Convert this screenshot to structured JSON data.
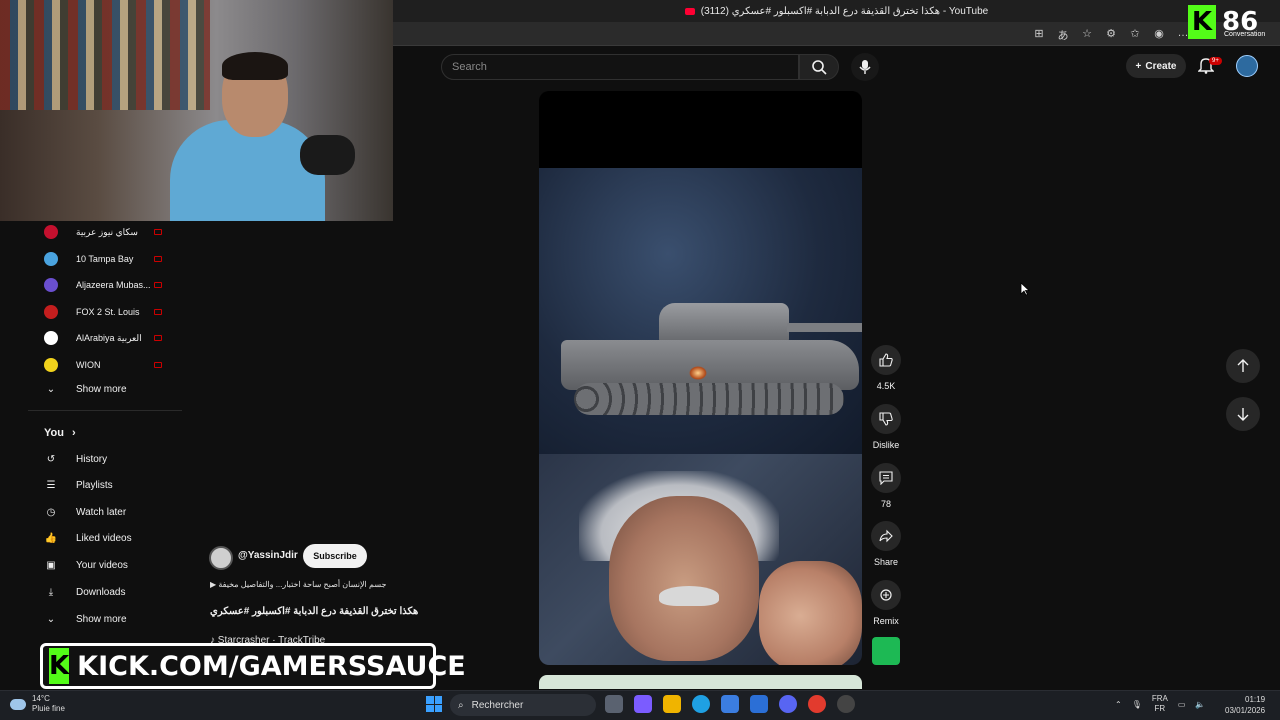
{
  "browser": {
    "tab_title": "(3112) هكذا تخترق القذيفة درع الدبابة #اكسبلور #عسكري - YouTube"
  },
  "kick_overlay": {
    "count": "86",
    "label": "Conversation"
  },
  "header": {
    "search_placeholder": "Search",
    "create_label": "Create",
    "notif_badge": "9+"
  },
  "sidebar": {
    "subscriptions": [
      {
        "label": "سكاي نيوز عربية",
        "color": "#c4102e",
        "live": true
      },
      {
        "label": "10 Tampa Bay",
        "color": "#4aa3df",
        "live": true
      },
      {
        "label": "Aljazeera Mubas...",
        "color": "#6a4fcf",
        "live": true
      },
      {
        "label": "FOX 2 St. Louis",
        "color": "#c41e1e",
        "live": true
      },
      {
        "label": "AlArabiya العربية",
        "color": "#ffffff",
        "live": true
      },
      {
        "label": "WION",
        "color": "#f1d21c",
        "live": true
      }
    ],
    "show_more_1": "Show more",
    "you_section": "You",
    "you_items": [
      {
        "label": "History",
        "icon": "history-icon"
      },
      {
        "label": "Playlists",
        "icon": "playlists-icon"
      },
      {
        "label": "Watch later",
        "icon": "watch-later-icon"
      },
      {
        "label": "Liked videos",
        "icon": "like-icon"
      },
      {
        "label": "Your videos",
        "icon": "your-videos-icon"
      },
      {
        "label": "Downloads",
        "icon": "download-icon"
      }
    ],
    "show_more_2": "Show more"
  },
  "short": {
    "channel_handle": "@YassinJdir",
    "subscribe_label": "Subscribe",
    "description": "جسم الإنسان أصبح ساحة اختبار... والتفاصيل مخيفة",
    "title": "هكذا تخترق القذيفة درع الدبابة #اكسبلور #عسكري",
    "music": "Starcrasher · TrackTribe"
  },
  "actions": {
    "likes": "4.5K",
    "dislike": "Dislike",
    "comments": "78",
    "share": "Share",
    "remix": "Remix"
  },
  "kick_banner": {
    "text": "KICK.COM/GAMERSSAUCE"
  },
  "taskbar": {
    "temperature": "14°C",
    "weather": "Pluie fine",
    "search_label": "Rechercher",
    "lang_top": "FRA",
    "lang_bottom": "FR",
    "time": "01:19",
    "date": "03/01/2026"
  }
}
